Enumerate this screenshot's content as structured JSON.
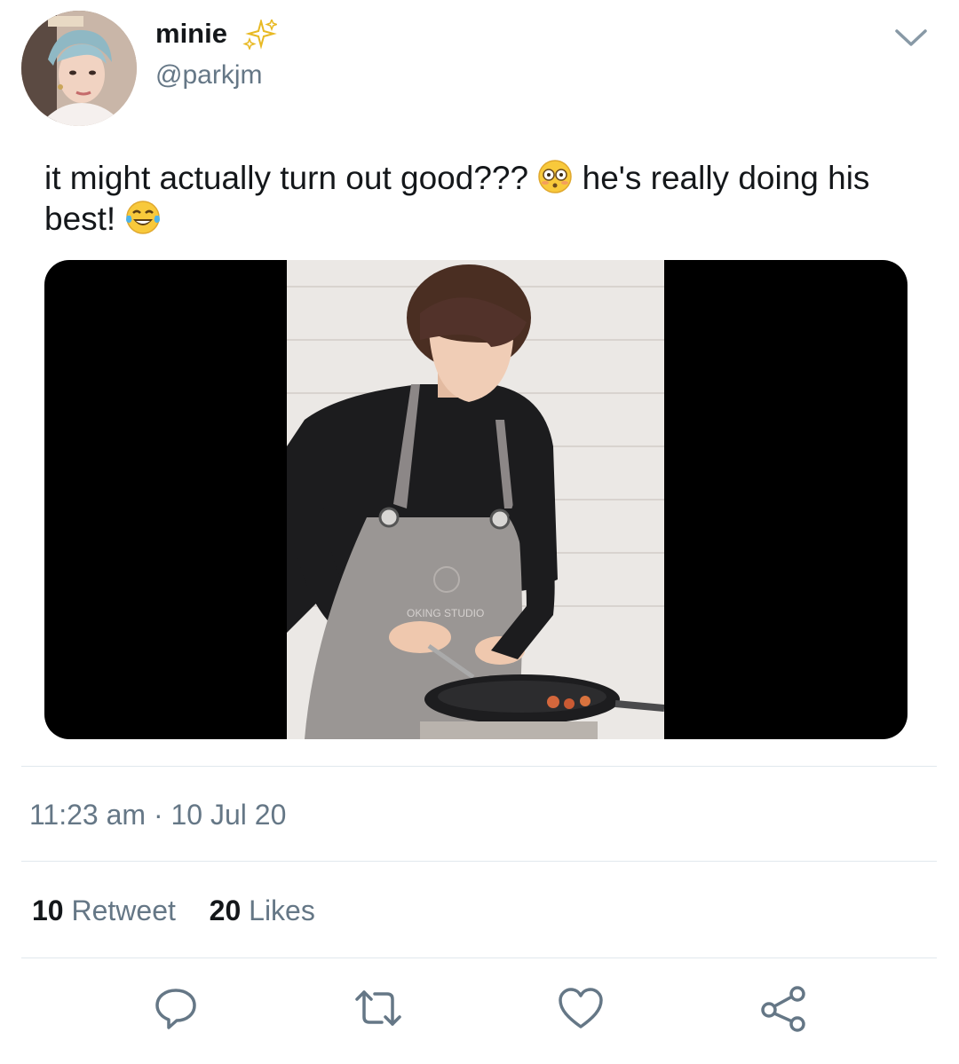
{
  "tweet": {
    "display_name": "minie",
    "name_emoji": "sparkles-emoji",
    "handle": "@parkjm",
    "text_part1": "it might actually turn out good??? ",
    "emoji1": "flushed-face-emoji",
    "text_part2": " he's really doing his best! ",
    "emoji2": "tears-of-joy-emoji",
    "media": {
      "description_icon": "photo-cooking",
      "apron_logo_text": "OKING STUDIO"
    },
    "timestamp": "11:23 am · 10 Jul 20",
    "stats": {
      "retweet_count": "10",
      "retweet_label": "Retweet",
      "likes_count": "20",
      "likes_label": "Likes"
    }
  },
  "actions": [
    {
      "icon": "reply-icon"
    },
    {
      "icon": "retweet-icon"
    },
    {
      "icon": "like-icon"
    },
    {
      "icon": "share-icon"
    }
  ],
  "colors": {
    "primary_text": "#14171a",
    "secondary_text": "#657786",
    "divider": "#e1e8ed",
    "sparkle": "#f4c430"
  }
}
